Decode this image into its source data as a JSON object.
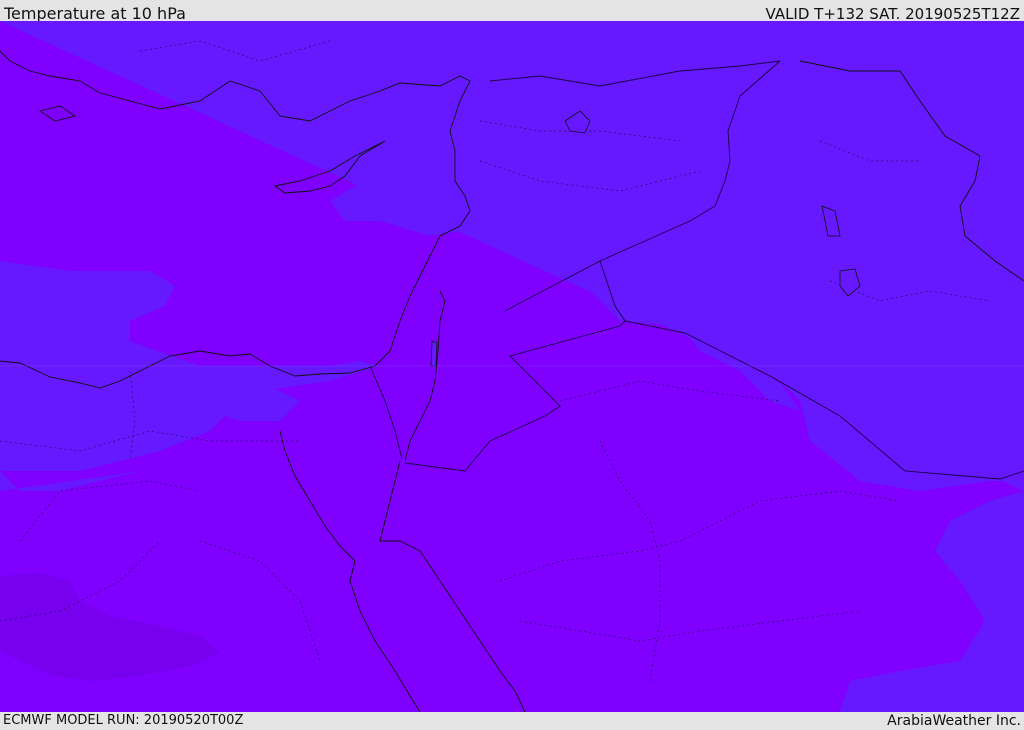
{
  "header": {
    "title": "Temperature at 10 hPa",
    "valid": "VALID T+132 SAT. 20190525T12Z"
  },
  "footer": {
    "model_run": "ECMWF MODEL RUN: 20190520T00Z",
    "credit": "ArabiaWeather Inc."
  },
  "map": {
    "colors": {
      "dark_band": "#7700ee",
      "main_band": "#7f00ff",
      "cool_band": "#6619ff",
      "coast": "#111111",
      "border": "#1a0044"
    }
  }
}
